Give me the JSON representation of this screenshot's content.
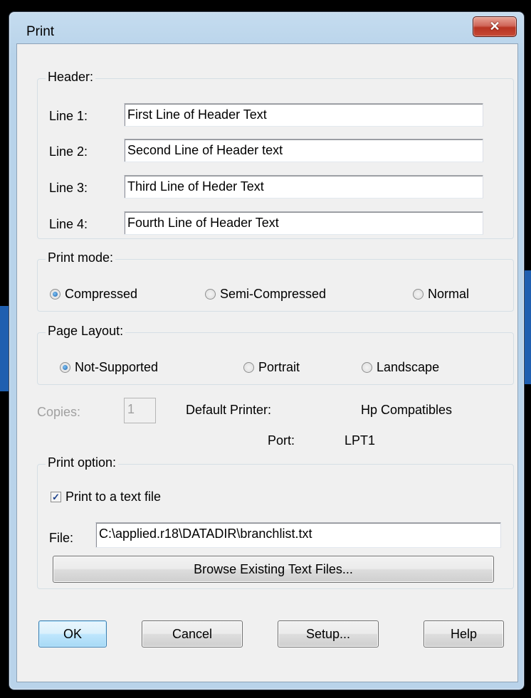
{
  "window": {
    "title": "Print",
    "close_glyph": "✕"
  },
  "header": {
    "label": "Header:",
    "lines": [
      {
        "label": "Line 1:",
        "value": "First Line of Header Text"
      },
      {
        "label": "Line 2:",
        "value": "Second Line of Header text"
      },
      {
        "label": "Line 3:",
        "value": "Third Line of Heder Text"
      },
      {
        "label": "Line 4:",
        "value": "Fourth Line of Header Text"
      }
    ]
  },
  "print_mode": {
    "label": "Print mode:",
    "options": [
      "Compressed",
      "Semi-Compressed",
      "Normal"
    ],
    "selected": "Compressed"
  },
  "page_layout": {
    "label": "Page Layout:",
    "options": [
      "Not-Supported",
      "Portrait",
      "Landscape"
    ],
    "selected": "Not-Supported"
  },
  "printer": {
    "copies_label": "Copies:",
    "copies_value": "1",
    "default_printer_label": "Default Printer:",
    "default_printer_value": "Hp Compatibles",
    "port_label": "Port:",
    "port_value": "LPT1"
  },
  "print_option": {
    "label": "Print option:",
    "checkbox_label": "Print to a text file",
    "checked": true,
    "file_label": "File:",
    "file_value": "C:\\applied.r18\\DATADIR\\branchlist.txt",
    "browse_label": "Browse Existing Text Files..."
  },
  "buttons": {
    "ok": "OK",
    "cancel": "Cancel",
    "setup": "Setup...",
    "help": "Help"
  }
}
